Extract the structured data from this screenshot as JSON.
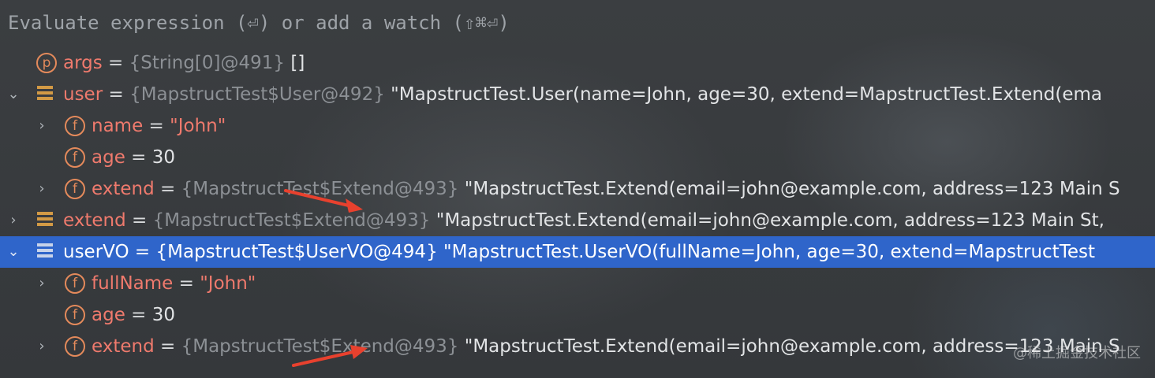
{
  "header": {
    "text": "Evaluate expression (⏎) or add a watch (⇧⌘⏎)"
  },
  "rows": [
    {
      "name": "args",
      "eq": " = ",
      "ref": "{String[0]@491}",
      "value": " []"
    },
    {
      "name": "user",
      "eq": " = ",
      "ref": "{MapstructTest$User@492}",
      "value": " \"MapstructTest.User(name=John, age=30, extend=MapstructTest.Extend(ema"
    },
    {
      "name": "name",
      "eq": " = ",
      "value": "\"John\""
    },
    {
      "name": "age",
      "eq": " = ",
      "value": "30"
    },
    {
      "name": "extend",
      "eq": " = ",
      "ref": "{MapstructTest$Extend@493}",
      "value": " \"MapstructTest.Extend(email=john@example.com, address=123 Main S"
    },
    {
      "name": "extend",
      "eq": " = ",
      "ref": "{MapstructTest$Extend@493}",
      "value": " \"MapstructTest.Extend(email=john@example.com, address=123 Main St,"
    },
    {
      "name": "userVO",
      "eq": " = ",
      "ref": "{MapstructTest$UserVO@494}",
      "value": " \"MapstructTest.UserVO(fullName=John, age=30, extend=MapstructTest"
    },
    {
      "name": "fullName",
      "eq": " = ",
      "value": "\"John\""
    },
    {
      "name": "age",
      "eq": " = ",
      "value": "30"
    },
    {
      "name": "extend",
      "eq": " = ",
      "ref": "{MapstructTest$Extend@493}",
      "value": " \"MapstructTest.Extend(email=john@example.com, address=123 Main S"
    }
  ],
  "icons": {
    "param": "p",
    "field": "f",
    "object": "object-icon"
  },
  "colors": {
    "selection": "#2f65ca",
    "name": "#ef7a6d",
    "arrow": "#e8412e"
  },
  "watermark": "@稀土掘金技术社区"
}
